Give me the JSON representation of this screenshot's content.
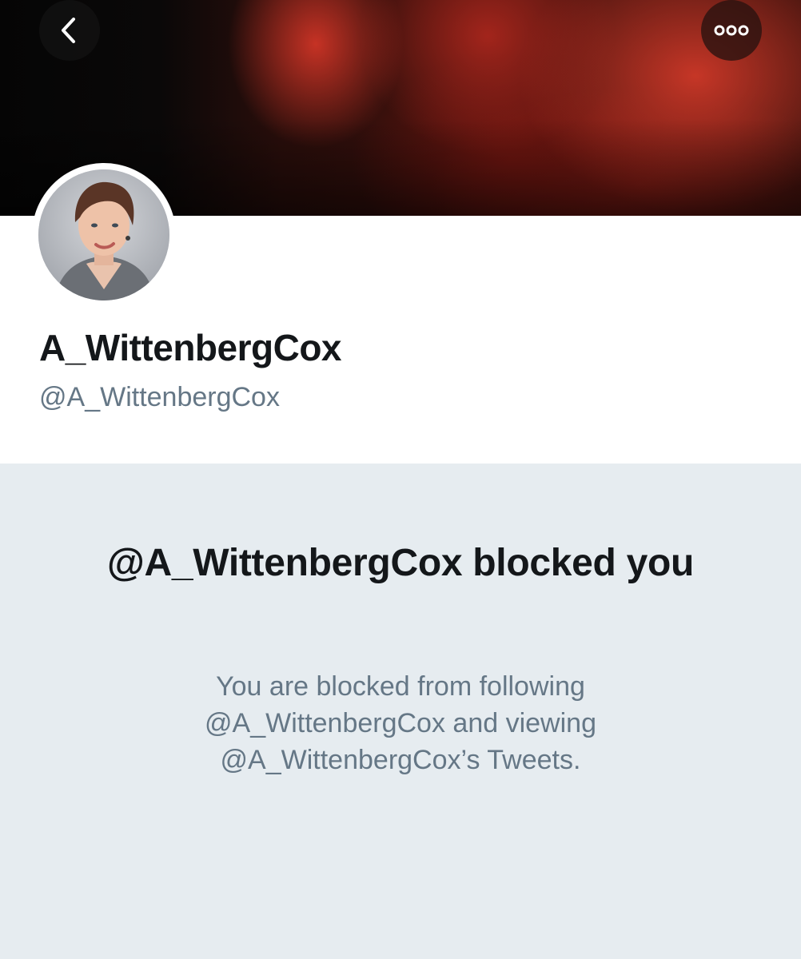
{
  "header": {
    "back_icon": "chevron-left-icon",
    "more_icon": "more-horizontal-icon"
  },
  "profile": {
    "display_name": "A_WittenbergCox",
    "handle": "@A_WittenbergCox"
  },
  "blocked": {
    "title": "@A_WittenbergCox blocked you",
    "description": "You are blocked from following @A_WittenbergCox and viewing @A_WittenbergCox’s Tweets."
  },
  "colors": {
    "background_panel": "#e6ecf0",
    "secondary_text": "#657786",
    "primary_text": "#14171a",
    "banner_accent": "#c8372a"
  }
}
